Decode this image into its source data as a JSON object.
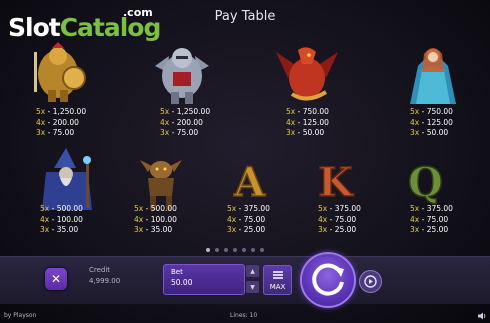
{
  "branding": {
    "logo_slot": "Slot",
    "logo_catalog": "Catalog",
    "logo_com": ".com",
    "provider": "by Playson"
  },
  "title": "Pay Table",
  "symbols_row1": [
    {
      "name": "golden-knight",
      "pays": [
        {
          "m": "5x",
          "v": "- 1,250.00"
        },
        {
          "m": "4x",
          "v": "- 200.00"
        },
        {
          "m": "3x",
          "v": "- 75.00"
        }
      ]
    },
    {
      "name": "silver-knight",
      "pays": [
        {
          "m": "5x",
          "v": "- 1,250.00"
        },
        {
          "m": "4x",
          "v": "- 200.00"
        },
        {
          "m": "3x",
          "v": "- 75.00"
        }
      ]
    },
    {
      "name": "red-dragon",
      "pays": [
        {
          "m": "5x",
          "v": "- 750.00"
        },
        {
          "m": "4x",
          "v": "- 125.00"
        },
        {
          "m": "3x",
          "v": "- 50.00"
        }
      ]
    },
    {
      "name": "blue-princess",
      "pays": [
        {
          "m": "5x",
          "v": "- 750.00"
        },
        {
          "m": "4x",
          "v": "- 125.00"
        },
        {
          "m": "3x",
          "v": "- 50.00"
        }
      ]
    }
  ],
  "symbols_row2": [
    {
      "name": "wizard",
      "pays": [
        {
          "m": "5x",
          "v": "- 500.00"
        },
        {
          "m": "4x",
          "v": "- 100.00"
        },
        {
          "m": "3x",
          "v": "- 35.00"
        }
      ]
    },
    {
      "name": "goblin",
      "pays": [
        {
          "m": "5x",
          "v": "- 500.00"
        },
        {
          "m": "4x",
          "v": "- 100.00"
        },
        {
          "m": "3x",
          "v": "- 35.00"
        }
      ]
    },
    {
      "name": "letter-a",
      "glyph": "A",
      "pays": [
        {
          "m": "5x",
          "v": "- 375.00"
        },
        {
          "m": "4x",
          "v": "- 75.00"
        },
        {
          "m": "3x",
          "v": "- 25.00"
        }
      ]
    },
    {
      "name": "letter-k",
      "glyph": "K",
      "pays": [
        {
          "m": "5x",
          "v": "- 375.00"
        },
        {
          "m": "4x",
          "v": "- 75.00"
        },
        {
          "m": "3x",
          "v": "- 25.00"
        }
      ]
    },
    {
      "name": "letter-q",
      "glyph": "Q",
      "pays": [
        {
          "m": "5x",
          "v": "- 375.00"
        },
        {
          "m": "4x",
          "v": "- 75.00"
        },
        {
          "m": "3x",
          "v": "- 25.00"
        }
      ]
    }
  ],
  "pagination": {
    "pages": 7,
    "active_index": 0
  },
  "controls": {
    "close_glyph": "✕",
    "credit_label": "Credit",
    "credit_value": "4,999.00",
    "bet_label": "Bet",
    "bet_value": "50.00",
    "bet_up_glyph": "▲",
    "bet_down_glyph": "▼",
    "max_label": "MAX",
    "lines_label": "Lines: 10"
  },
  "icons": {
    "spin": "spin-arrow-icon",
    "auto": "autoplay-icon",
    "sound": "speaker-icon",
    "max": "stack-icon"
  },
  "colors": {
    "multiplier": "#e5c94a",
    "accent": "#7b46c9",
    "logo_green": "#7bc043"
  }
}
